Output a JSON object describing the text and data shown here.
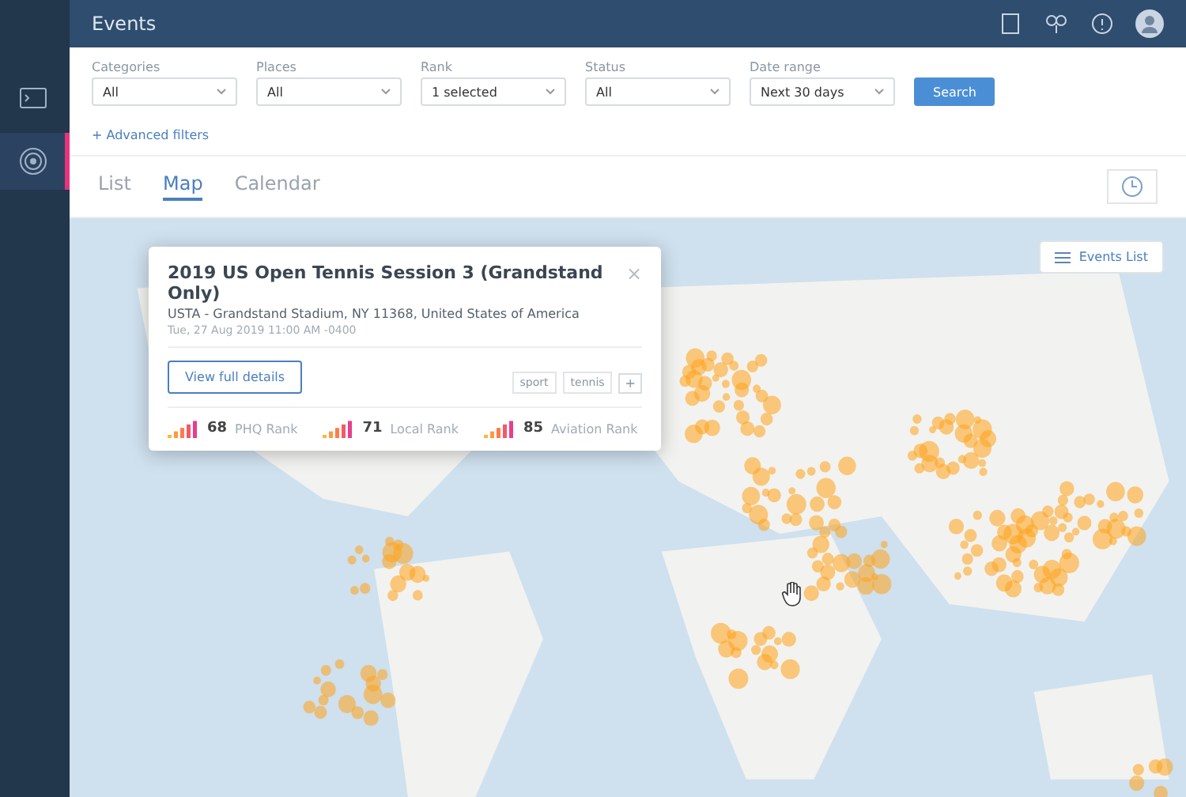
{
  "sidebar": {
    "items": [
      {
        "selected": false
      },
      {
        "selected": true
      }
    ]
  },
  "header": {
    "title": "Events"
  },
  "filters": [
    {
      "label": "Categories",
      "value": "All"
    },
    {
      "label": "Places",
      "value": "All"
    },
    {
      "label": "Rank",
      "value": "1 selected"
    },
    {
      "label": "Status",
      "value": "All"
    },
    {
      "label": "Date range",
      "value": "Next 30 days"
    }
  ],
  "search_button": "Search",
  "advanced_filters": "+ Advanced filters",
  "view_tabs": [
    {
      "label": "List",
      "selected": false
    },
    {
      "label": "Map",
      "selected": true
    },
    {
      "label": "Calendar",
      "selected": false
    }
  ],
  "events_list_button": "Events List",
  "popup": {
    "title": "2019 US Open Tennis Session 3 (Grandstand Only)",
    "venue": "USTA - Grandstand Stadium, NY 11368, United States of America",
    "datetime": "Tue, 27 Aug 2019 11:00 AM -0400",
    "close": "×",
    "details_button": "View full details",
    "tags": [
      "sport",
      "tennis"
    ],
    "more_button": "+",
    "ranks": [
      {
        "value": "68",
        "label": "PHQ Rank"
      },
      {
        "value": "71",
        "label": "Local Rank"
      },
      {
        "value": "85",
        "label": "Aviation Rank"
      }
    ]
  }
}
